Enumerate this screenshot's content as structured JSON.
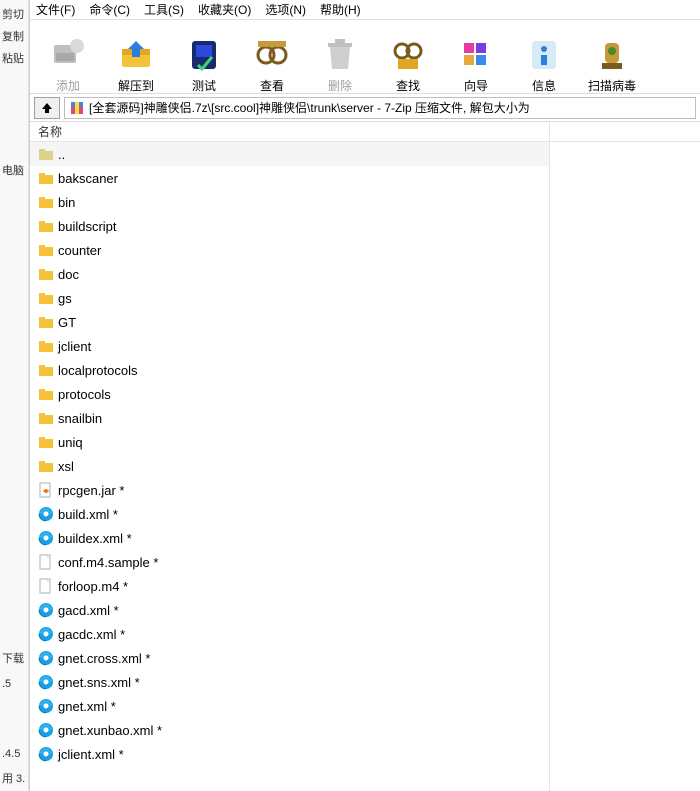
{
  "left_strip": {
    "cut": "剪切",
    "copy": "复制",
    "paste": "粘贴",
    "computer_frag": "电脑",
    "dl_frag1": "下载",
    "dl_frag2": ".5",
    "dl_frag3": ".4.5",
    "dl_frag4": "用 3."
  },
  "menu": {
    "file": "文件(F)",
    "cmd": "命令(C)",
    "tools": "工具(S)",
    "fav": "收藏夹(O)",
    "options": "选项(N)",
    "help": "帮助(H)"
  },
  "toolbar": {
    "add": "添加",
    "extract": "解压到",
    "test": "测试",
    "view": "查看",
    "delete": "删除",
    "find": "查找",
    "wizard": "向导",
    "info": "信息",
    "virus": "扫描病毒"
  },
  "path": "[全套源码]神雕侠侣.7z\\[src.cool]神雕侠侣\\trunk\\server - 7-Zip 压缩文件, 解包大小为",
  "header": {
    "name": "名称"
  },
  "items": [
    {
      "name": "..",
      "type": "up"
    },
    {
      "name": "bakscaner",
      "type": "folder"
    },
    {
      "name": "bin",
      "type": "folder"
    },
    {
      "name": "buildscript",
      "type": "folder"
    },
    {
      "name": "counter",
      "type": "folder"
    },
    {
      "name": "doc",
      "type": "folder"
    },
    {
      "name": "gs",
      "type": "folder"
    },
    {
      "name": "GT",
      "type": "folder"
    },
    {
      "name": "jclient",
      "type": "folder"
    },
    {
      "name": "localprotocols",
      "type": "folder"
    },
    {
      "name": "protocols",
      "type": "folder"
    },
    {
      "name": "snailbin",
      "type": "folder"
    },
    {
      "name": "uniq",
      "type": "folder"
    },
    {
      "name": "xsl",
      "type": "folder"
    },
    {
      "name": "rpcgen.jar *",
      "type": "jar"
    },
    {
      "name": "build.xml *",
      "type": "xml"
    },
    {
      "name": "buildex.xml *",
      "type": "xml"
    },
    {
      "name": "conf.m4.sample *",
      "type": "file"
    },
    {
      "name": "forloop.m4 *",
      "type": "file"
    },
    {
      "name": "gacd.xml *",
      "type": "xml"
    },
    {
      "name": "gacdc.xml *",
      "type": "xml"
    },
    {
      "name": "gnet.cross.xml *",
      "type": "xml"
    },
    {
      "name": "gnet.sns.xml *",
      "type": "xml"
    },
    {
      "name": "gnet.xml *",
      "type": "xml"
    },
    {
      "name": "gnet.xunbao.xml *",
      "type": "xml"
    },
    {
      "name": "jclient.xml *",
      "type": "xml"
    }
  ]
}
